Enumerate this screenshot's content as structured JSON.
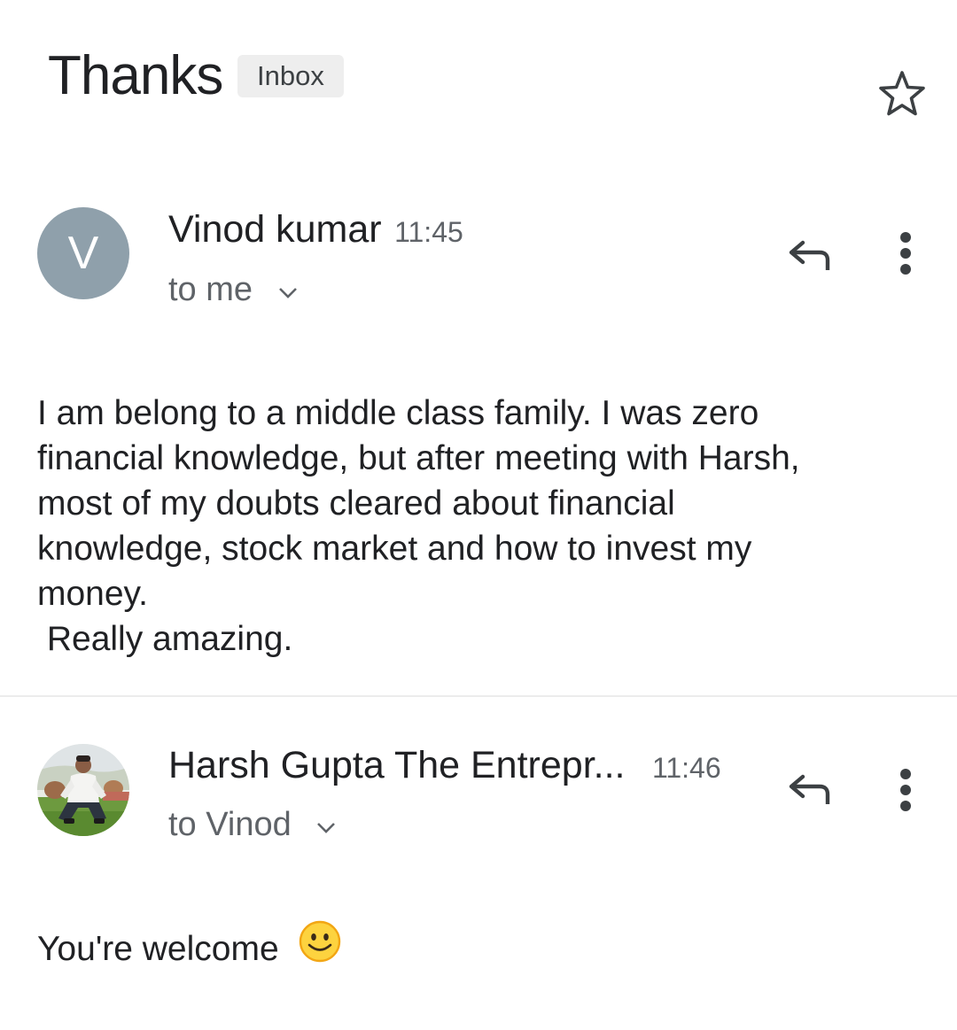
{
  "header": {
    "subject": "Thanks",
    "label": "Inbox",
    "star_icon": "star-outline-icon"
  },
  "messages": [
    {
      "avatar_letter": "V",
      "avatar_color": "#8fa0ab",
      "sender": "Vinod kumar",
      "time": "11:45",
      "recipient": "to me",
      "body_lines": [
        "I am belong to a middle class family. I was zero",
        "financial knowledge, but after meeting with Harsh,",
        "most of my doubts cleared about financial",
        "knowledge, stock market and how to invest my",
        "money.",
        " Really amazing."
      ],
      "reply_icon": "reply-icon",
      "more_icon": "more-vert-icon"
    },
    {
      "avatar_type": "photo",
      "sender": "Harsh Gupta The Entrepr...",
      "time": "11:46",
      "recipient": "to Vinod",
      "body": "You're welcome",
      "emoji_icon": "smiley-emoji-icon",
      "reply_icon": "reply-icon",
      "more_icon": "more-vert-icon"
    }
  ],
  "colors": {
    "text_primary": "#202124",
    "text_secondary": "#5f6368",
    "chip_bg": "#eeeeee",
    "divider": "#ececec"
  }
}
